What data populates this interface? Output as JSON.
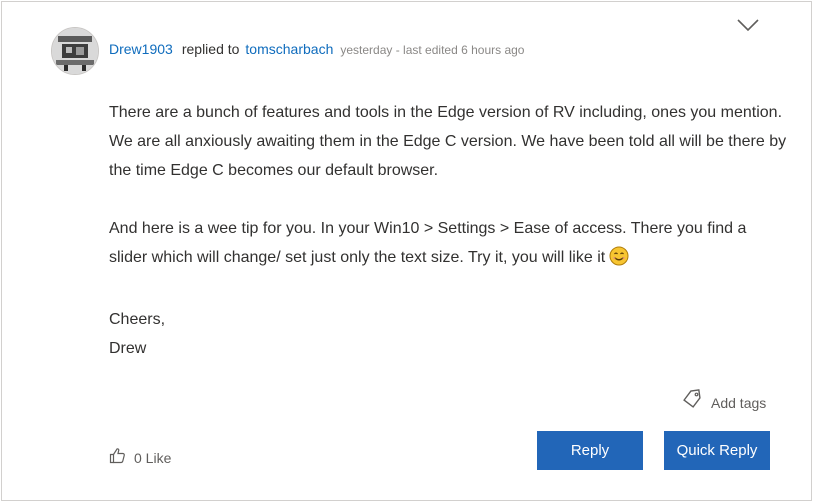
{
  "post": {
    "author": "Drew1903",
    "replied_text": "replied to",
    "reply_target": "tomscharbach",
    "meta": "yesterday - last edited 6 hours ago",
    "paragraph1": "There are a bunch of features and tools in the Edge version of RV including, ones you mention. We are all anxiously awaiting them in the Edge C version. We have been told all will be there by the time Edge C becomes our default browser.",
    "paragraph2": "And here is a wee tip for you. In your Win10 > Settings > Ease of access. There you find a slider which will change/ set just only the text size. Try it, you will like it",
    "signoff_line1": "Cheers,",
    "signoff_line2": "Drew"
  },
  "actions": {
    "add_tags_label": "Add tags",
    "like_label": "0 Like",
    "reply_label": "Reply",
    "quick_reply_label": "Quick Reply"
  },
  "icons": {
    "menu": "chevron-down-icon",
    "tag": "tag-icon",
    "like": "thumbs-up-icon",
    "emoji": "smiling-face-emoji"
  },
  "colors": {
    "link": "#0f6cbd",
    "button": "#2266b8",
    "meta": "#8a8886"
  }
}
